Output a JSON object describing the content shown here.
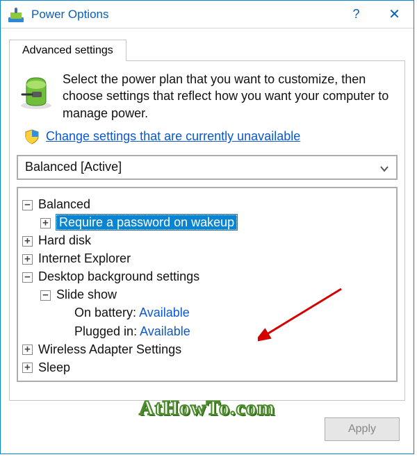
{
  "title": "Power Options",
  "tab": "Advanced settings",
  "intro": "Select the power plan that you want to customize, then choose settings that reflect how you want your computer to manage power.",
  "link": "Change settings that are currently unavailable",
  "plan": "Balanced [Active]",
  "tree": {
    "balanced": "Balanced",
    "require_pw": "Require a password on wakeup",
    "hard_disk": "Hard disk",
    "ie": "Internet Explorer",
    "desktop_bg": "Desktop background settings",
    "slideshow": "Slide show",
    "on_battery_label": "On battery: ",
    "on_battery_value": "Available",
    "plugged_in_label": "Plugged in: ",
    "plugged_in_value": "Available",
    "wireless": "Wireless Adapter Settings",
    "sleep": "Sleep"
  },
  "buttons": {
    "apply": "Apply"
  },
  "watermark": "AtHowTo.com"
}
